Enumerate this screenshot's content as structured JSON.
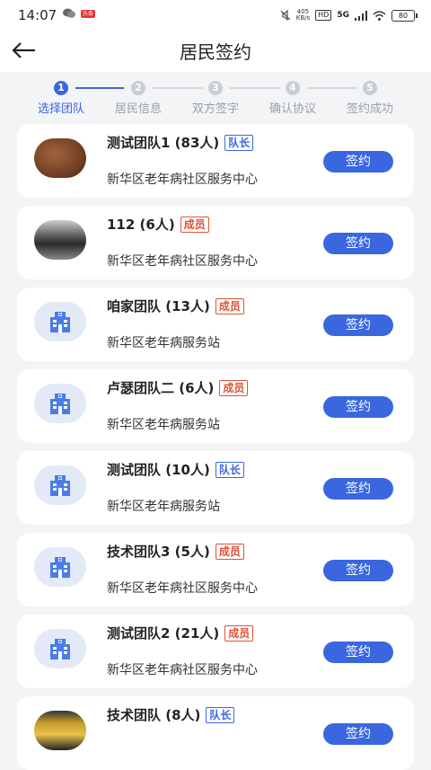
{
  "status_bar": {
    "time": "14:07",
    "badge": "头条",
    "net_speed_top": "405",
    "net_speed_bottom": "KB/s",
    "hd": "HD",
    "network": "5G",
    "battery": "80"
  },
  "header": {
    "title": "居民签约"
  },
  "steps": [
    {
      "num": "1",
      "label": "选择团队"
    },
    {
      "num": "2",
      "label": "居民信息"
    },
    {
      "num": "3",
      "label": "双方签字"
    },
    {
      "num": "4",
      "label": "确认协议"
    },
    {
      "num": "5",
      "label": "签约成功"
    }
  ],
  "teams": [
    {
      "name": "测试团队1 (83人)",
      "role": "队长",
      "org": "新华区老年病社区服务中心",
      "avatar": "photo-food"
    },
    {
      "name": "112 (6人)",
      "role": "成员",
      "org": "新华区老年病社区服务中心",
      "avatar": "photo-keyboard"
    },
    {
      "name": "咱家团队 (13人)",
      "role": "成员",
      "org": "新华区老年病服务站",
      "avatar": "hospital-icon"
    },
    {
      "name": "卢瑟团队二 (6人)",
      "role": "成员",
      "org": "新华区老年病服务站",
      "avatar": "hospital-icon"
    },
    {
      "name": "测试团队 (10人)",
      "role": "队长",
      "org": "新华区老年病服务站",
      "avatar": "hospital-icon"
    },
    {
      "name": "技术团队3 (5人)",
      "role": "成员",
      "org": "新华区老年病社区服务中心",
      "avatar": "hospital-icon"
    },
    {
      "name": "测试团队2 (21人)",
      "role": "成员",
      "org": "新华区老年病社区服务中心",
      "avatar": "hospital-icon"
    },
    {
      "name": "技术团队 (8人)",
      "role": "队长",
      "org": "",
      "avatar": "photo-other"
    }
  ],
  "sign_label": "签约",
  "colors": {
    "primary": "#3a67e0",
    "leader_tag": "#3a67e0",
    "member_tag": "#e0513a",
    "background": "#f3f4f6"
  }
}
